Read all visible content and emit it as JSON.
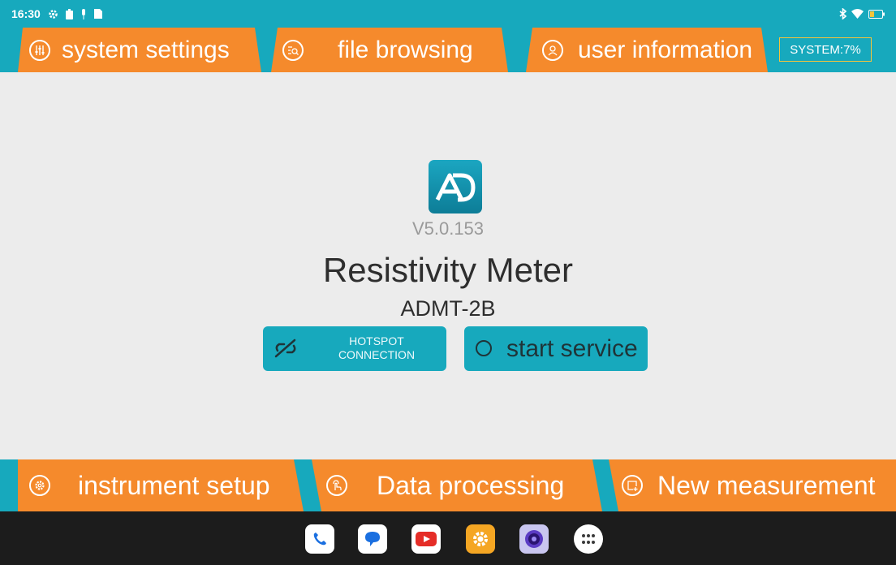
{
  "status_bar": {
    "time": "16:30"
  },
  "top_tabs": [
    {
      "label": "system settings",
      "icon": "sliders-icon"
    },
    {
      "label": "file browsing",
      "icon": "file-search-icon"
    },
    {
      "label": "user information",
      "icon": "user-icon"
    }
  ],
  "system_badge": "SYSTEM:7%",
  "app": {
    "version": "V5.0.153",
    "title": "Resistivity Meter",
    "model": "ADMT-2B"
  },
  "buttons": {
    "hotspot_line1": "HOTSPOT",
    "hotspot_line2": "CONNECTION",
    "start_service": "start service"
  },
  "bottom_tabs": [
    {
      "label": "instrument setup",
      "icon": "gear-icon"
    },
    {
      "label": "Data processing",
      "icon": "touch-icon"
    },
    {
      "label": "New measurement",
      "icon": "add-document-icon"
    }
  ],
  "dock": [
    "phone-icon",
    "messages-icon",
    "youtube-icon",
    "settings-icon",
    "camera-icon",
    "app-drawer-icon"
  ],
  "colors": {
    "accent": "#17a9bd",
    "tab": "#f58a2c",
    "badge_border": "#f5c43a"
  }
}
